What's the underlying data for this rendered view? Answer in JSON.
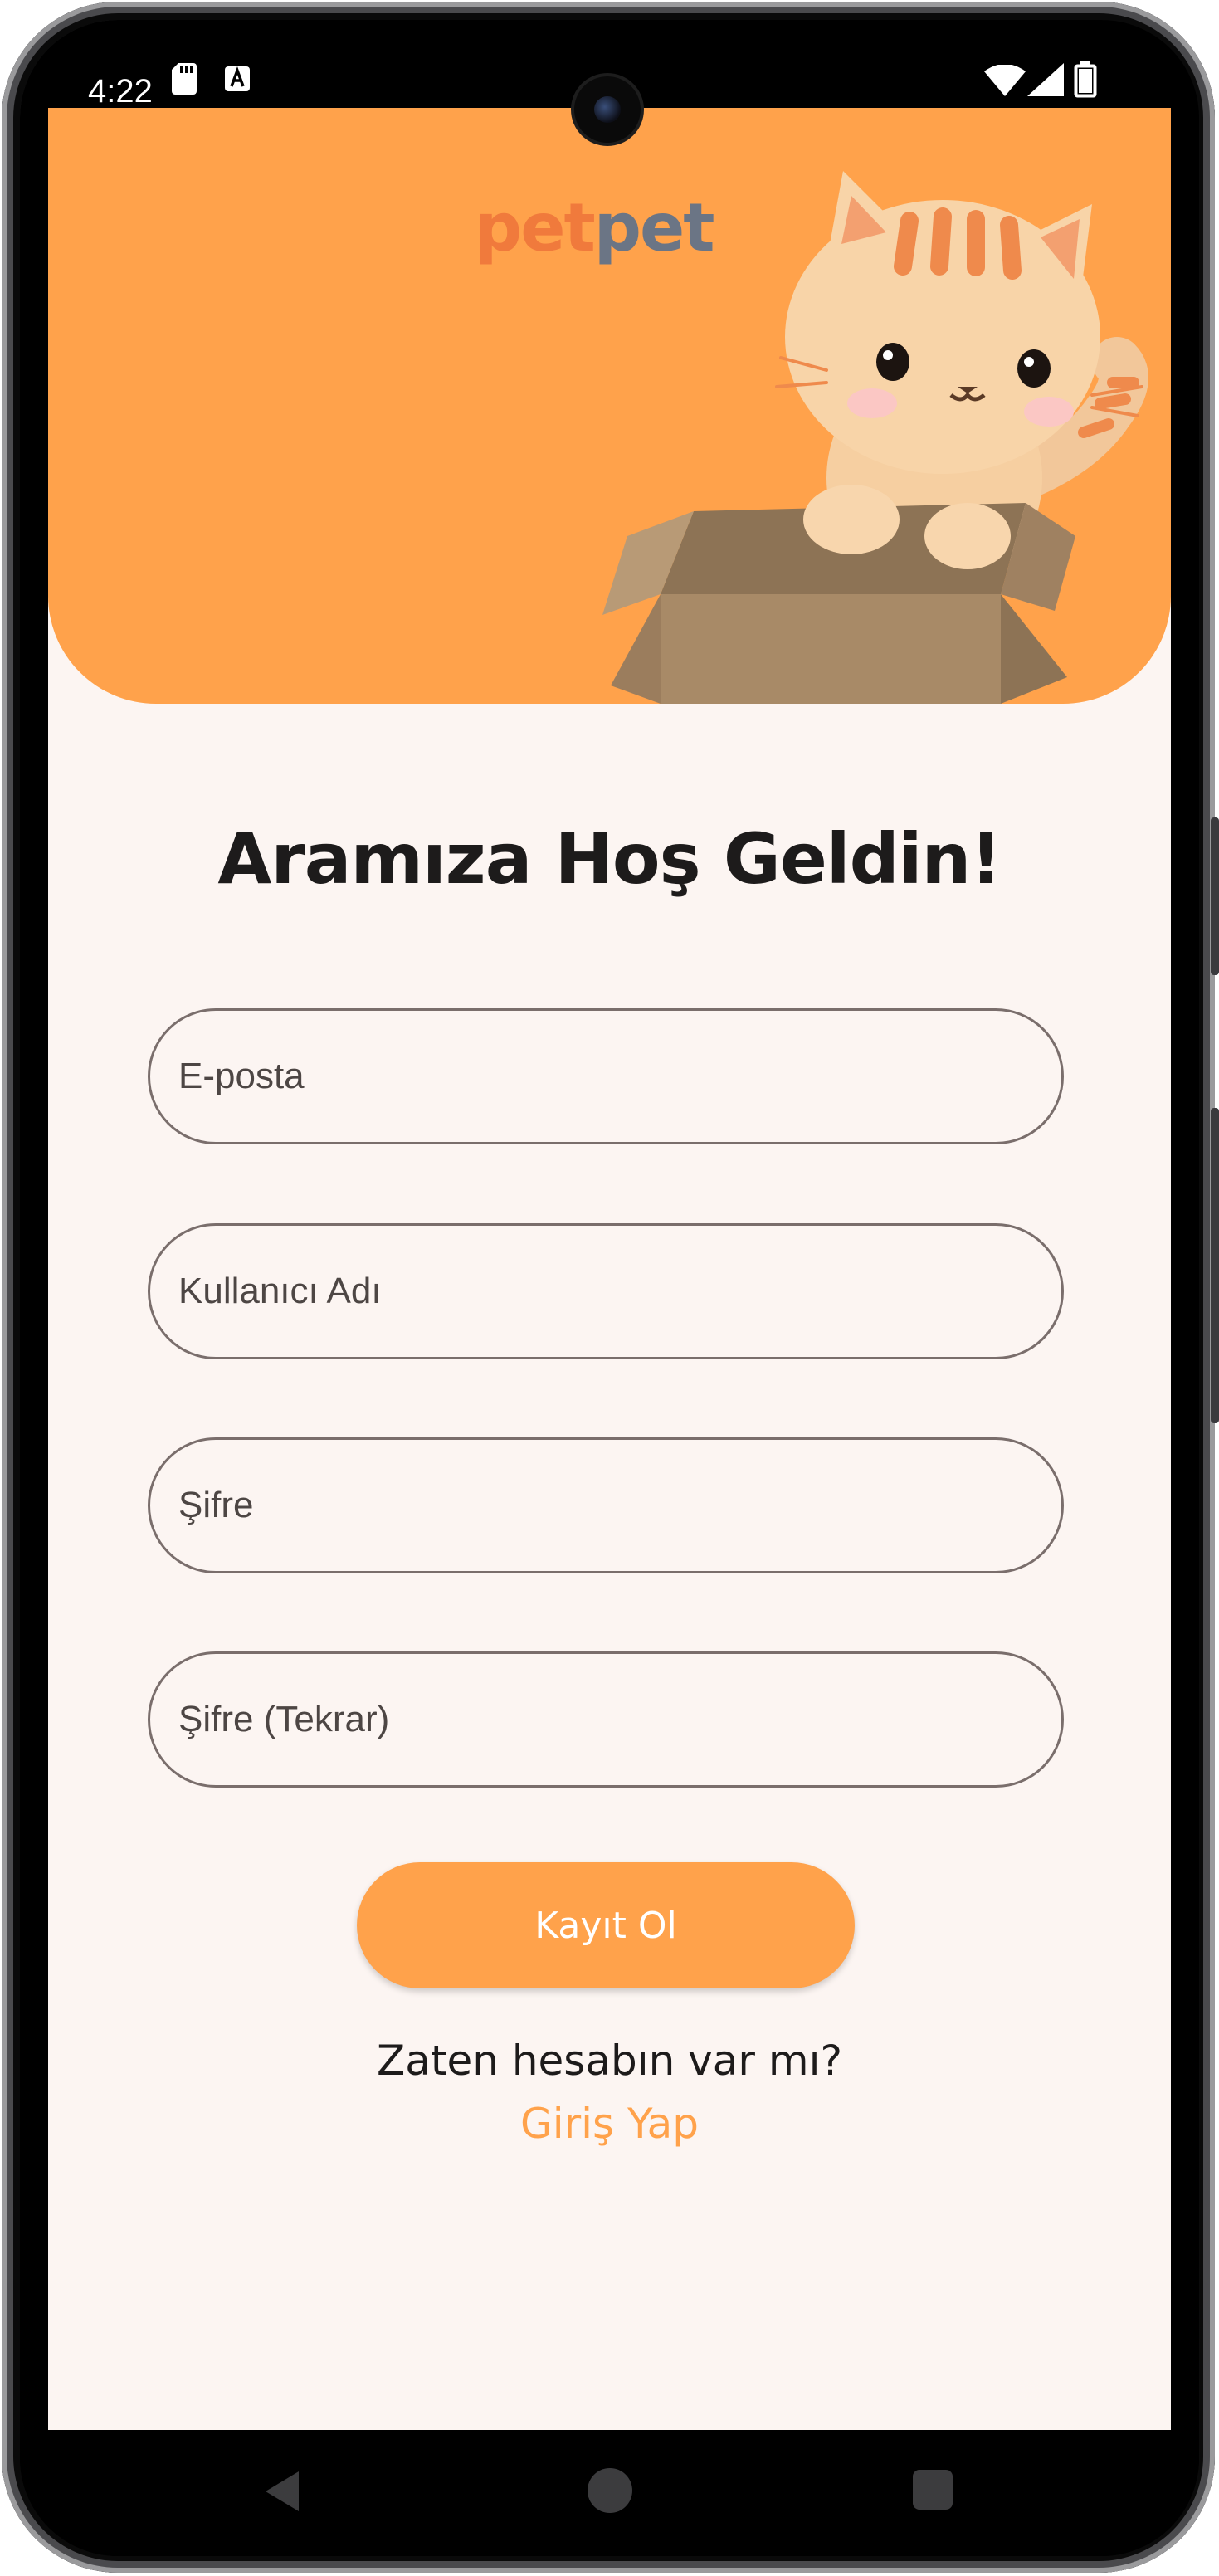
{
  "status_bar": {
    "time": "4:22",
    "icons": [
      "sd-card-icon",
      "keyboard-a-icon",
      "wifi-icon",
      "signal-icon",
      "battery-icon"
    ]
  },
  "header": {
    "logo_part1": "pet",
    "logo_part2": "pet",
    "background_color": "#ffa24b",
    "illustration": "cat-in-box-illustration"
  },
  "signup": {
    "heading": "Aramıza Hoş Geldin!",
    "fields": [
      {
        "label": "E-posta"
      },
      {
        "label": "Kullanıcı Adı"
      },
      {
        "label": "Şifre"
      },
      {
        "label": "Şifre (Tekrar)"
      }
    ],
    "submit_label": "Kayıt Ol",
    "login_prompt": "Zaten hesabın var mı?",
    "login_link": "Giriş Yap"
  },
  "nav_bar": {
    "icons": [
      "back-icon",
      "home-icon",
      "recent-apps-icon"
    ]
  },
  "colors": {
    "accent": "#ffa24b",
    "background": "#fcf5f2",
    "text": "#1d1b1b",
    "logo_orange": "#f07a3c",
    "logo_gray": "#6b7585"
  }
}
